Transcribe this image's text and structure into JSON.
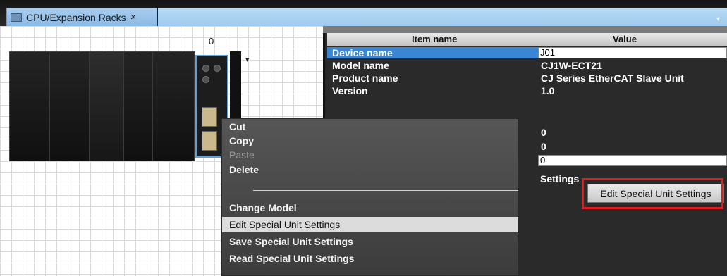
{
  "tab": {
    "title": "CPU/Expansion Racks",
    "close": "×",
    "dropdown": "▾"
  },
  "rack": {
    "number": "0",
    "arrow": "▾"
  },
  "props": {
    "header": {
      "item": "Item name",
      "value": "Value"
    },
    "rows": [
      {
        "name": "Device name",
        "value": "J01"
      },
      {
        "name": "Model name",
        "value": "CJ1W-ECT21"
      },
      {
        "name": "Product name",
        "value": "CJ Series EtherCAT Slave Unit"
      },
      {
        "name": "Version",
        "value": "1.0"
      },
      {
        "name": "",
        "value": "0"
      },
      {
        "name": "",
        "value": "0"
      },
      {
        "name": "",
        "value": "0"
      }
    ],
    "settings_label": "Settings",
    "edit_button": "Edit Special Unit Settings"
  },
  "context_menu": {
    "items": [
      {
        "label": "Cut"
      },
      {
        "label": "Copy"
      },
      {
        "label": "Paste"
      },
      {
        "label": "Delete"
      },
      {
        "label": "Change Model"
      },
      {
        "label": "Edit Special Unit Settings"
      },
      {
        "label": "Save Special Unit Settings"
      },
      {
        "label": "Read Special Unit Settings"
      }
    ]
  },
  "colors": {
    "selection": "#3b85d5",
    "highlight": "#e21c1c",
    "tab": "#9cc4eb"
  }
}
